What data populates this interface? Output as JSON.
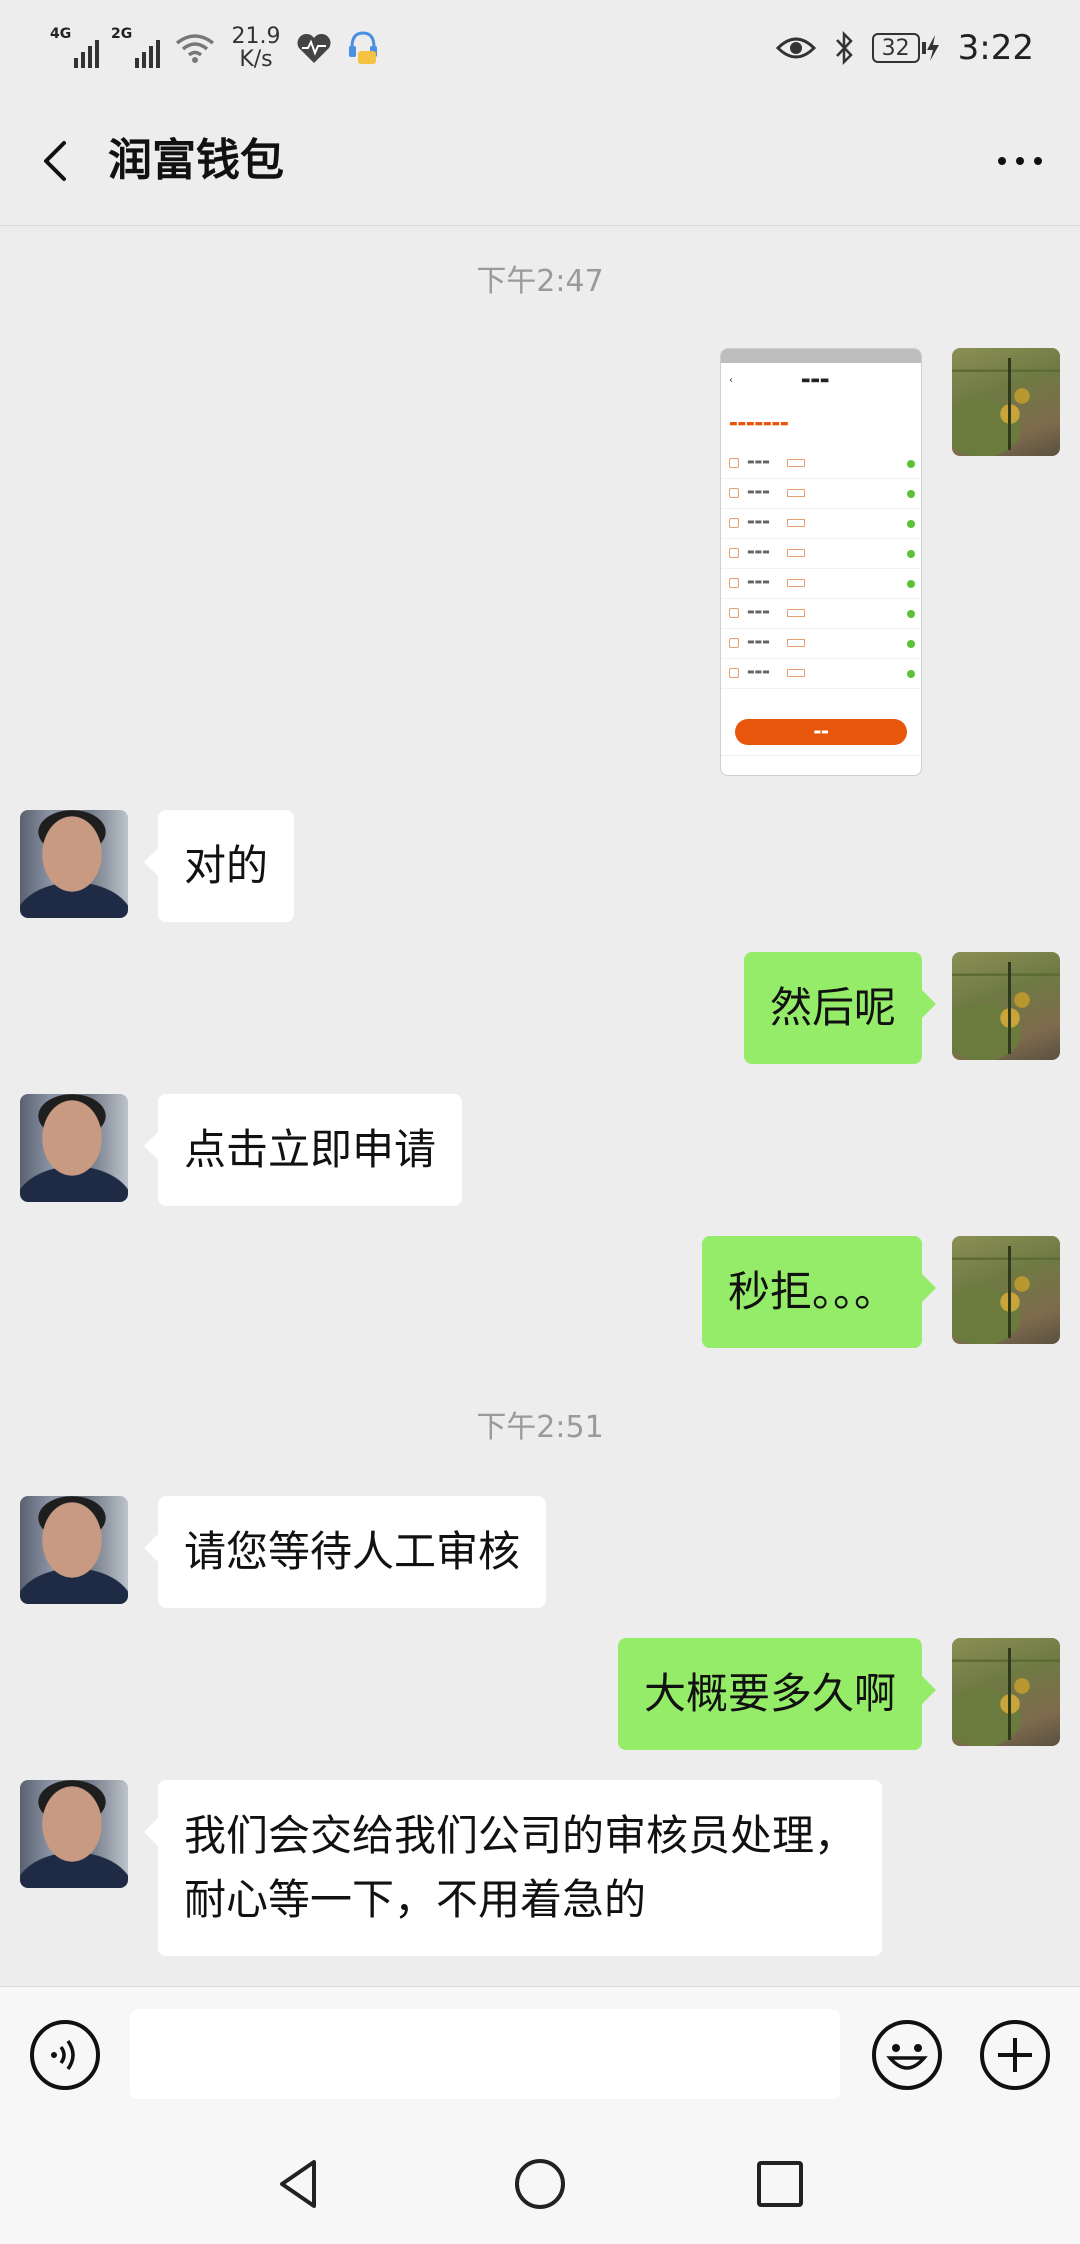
{
  "status_bar": {
    "net1": "4G",
    "net2": "2G",
    "speed_value": "21.9",
    "speed_unit": "K/s",
    "battery": "32",
    "time": "3:22"
  },
  "header": {
    "title": "润富钱包"
  },
  "chat": {
    "timestamps": [
      "下午2:47",
      "下午2:51"
    ],
    "messages": [
      {
        "side": "right",
        "type": "image"
      },
      {
        "side": "left",
        "text": "对的"
      },
      {
        "side": "right",
        "text": "然后呢"
      },
      {
        "side": "left",
        "text": "点击立即申请"
      },
      {
        "side": "right",
        "text": "秒拒。。。"
      },
      {
        "side": "left",
        "text": "请您等待人工审核"
      },
      {
        "side": "right",
        "text": "大概要多久啊"
      },
      {
        "side": "left",
        "lines": [
          "我们会交给我们公司的审核员处理，",
          "耐心等一下，不用着急的"
        ]
      }
    ]
  },
  "input": {
    "value": "",
    "placeholder": ""
  },
  "icons": {
    "back": "back-arrow-icon",
    "more": "more-dots-icon",
    "voice": "voice-icon",
    "emoji": "emoji-icon",
    "plus": "plus-icon"
  },
  "colors": {
    "background": "#ededed",
    "bubble_self": "#95ec69",
    "bubble_other": "#ffffff",
    "timestamp": "#9a9a9a"
  }
}
